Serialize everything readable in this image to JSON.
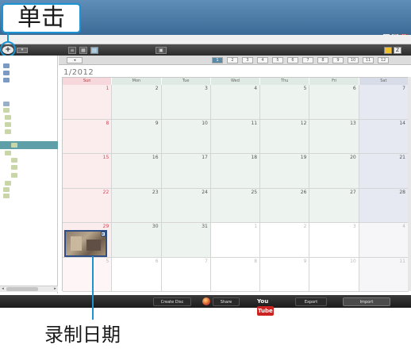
{
  "annotation": {
    "callout_text": "单击",
    "bottom_label": "录制日期"
  },
  "window": {
    "title": "",
    "menu_text": "",
    "controls": [
      "_",
      "□",
      "X"
    ]
  },
  "toolbar": {
    "add_glyph": "+",
    "view_icons": [
      "list-icon",
      "grid-icon",
      "calendar-icon"
    ],
    "center_icon": "picture-icon"
  },
  "sidebar": {
    "items": [
      {
        "label": "",
        "icon": "drive-icon",
        "selected": false
      },
      {
        "label": "",
        "icon": "drive-icon",
        "selected": false
      },
      {
        "label": "",
        "icon": "drive-icon",
        "selected": false
      },
      {
        "label": "",
        "icon": "library-icon",
        "selected": false
      },
      {
        "label": "",
        "icon": "folder-icon",
        "selected": false
      },
      {
        "label": "",
        "icon": "folder-icon",
        "selected": false
      },
      {
        "label": "",
        "icon": "folder-icon",
        "selected": false
      },
      {
        "label": "",
        "icon": "folder-icon",
        "selected": false
      },
      {
        "label": "",
        "icon": "folder-icon",
        "selected": true
      },
      {
        "label": "",
        "icon": "folder-icon",
        "selected": false
      },
      {
        "label": "",
        "icon": "folder-icon",
        "selected": false
      },
      {
        "label": "",
        "icon": "folder-icon",
        "selected": false
      },
      {
        "label": "",
        "icon": "folder-icon",
        "selected": false
      },
      {
        "label": "",
        "icon": "folder-icon",
        "selected": false
      },
      {
        "label": "",
        "icon": "folder-icon",
        "selected": false
      },
      {
        "label": "",
        "icon": "folder-icon",
        "selected": false
      }
    ]
  },
  "calendar": {
    "title": "1/2012",
    "month_buttons": [
      "1",
      "2",
      "3",
      "4",
      "5",
      "6",
      "7",
      "8",
      "9",
      "10",
      "11",
      "12"
    ],
    "active_month": "1",
    "weekdays": [
      "Sun",
      "Mon",
      "Tue",
      "Wed",
      "Thu",
      "Fri",
      "Sat"
    ],
    "weeks": [
      [
        "1",
        "2",
        "3",
        "4",
        "5",
        "6",
        "7"
      ],
      [
        "8",
        "9",
        "10",
        "11",
        "12",
        "13",
        "14"
      ],
      [
        "15",
        "16",
        "17",
        "18",
        "19",
        "20",
        "21"
      ],
      [
        "22",
        "23",
        "24",
        "25",
        "26",
        "27",
        "28"
      ],
      [
        "29",
        "30",
        "31",
        "1",
        "2",
        "3",
        "4"
      ],
      [
        "5",
        "6",
        "7",
        "8",
        "9",
        "10",
        "11"
      ]
    ],
    "video_date": "29"
  },
  "bottombar": {
    "buttons": [
      {
        "label": "Create Disc",
        "style": "dark"
      },
      {
        "label": "Share",
        "style": "dark"
      },
      {
        "label": "Export",
        "style": "dark"
      },
      {
        "label": "Import",
        "style": "accent"
      }
    ],
    "youtube_logo_parts": [
      "You",
      "Tube"
    ]
  }
}
